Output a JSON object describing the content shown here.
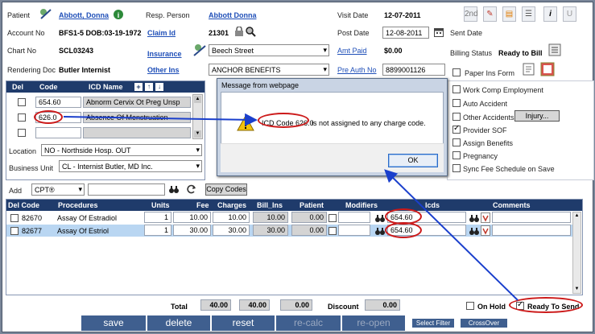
{
  "header": {
    "patient_label": "Patient",
    "patient_name": "Abbott, Donna",
    "resp_person_label": "Resp. Person",
    "resp_person_value": "Abbott Donna",
    "visit_date_label": "Visit Date",
    "visit_date_value": "12-07-2011",
    "account_label": "Account No",
    "account_value": "BFS1-5 DOB:03-19-1972",
    "claim_id_label": "Claim Id",
    "claim_id_value": "21301",
    "post_date_label": "Post Date",
    "post_date_value": "12-08-2011",
    "sent_date_label": "Sent Date",
    "chart_label": "Chart No",
    "chart_value": "SCL03243",
    "insurance_label": "Insurance",
    "insurance_value": "Beech Street",
    "amt_paid_label": "Amt Paid",
    "amt_paid_value": "$0.00",
    "billing_status_label": "Billing Status",
    "billing_status_value": "Ready to Bill",
    "rendering_label": "Rendering Doc",
    "rendering_value": "Butler Internist",
    "other_ins_label": "Other Ins",
    "other_ins_value": "ANCHOR BENEFITS",
    "pre_auth_label": "Pre Auth No",
    "pre_auth_value": "8899001126",
    "paper_ins_label": "Paper Ins Form"
  },
  "toolbar": {
    "btn_2nd": "2nd",
    "btn_info": "i",
    "btn_u": "U"
  },
  "icd": {
    "headers": {
      "del": "Del",
      "code": "Code",
      "name": "ICD Name"
    },
    "rows": [
      {
        "code": "654.60",
        "name": "Abnorm Cervix Ot Preg Unsp"
      },
      {
        "code": "626.0",
        "name": "Absence Of Menstruation"
      },
      {
        "code": "",
        "name": ""
      }
    ]
  },
  "location": {
    "label": "Location",
    "value": "NO - Northside Hosp. OUT"
  },
  "business_unit": {
    "label": "Business Unit",
    "value": "CL - Internist Butler, MD Inc."
  },
  "options": {
    "work_comp": "Work Comp Employment",
    "auto_accident": "Auto Accident",
    "other_accidents": "Other Accidents",
    "injury_btn": "Injury...",
    "provider_sof": "Provider SOF",
    "assign_benefits": "Assign Benefits",
    "pregnancy": "Pregnancy",
    "sync_fee": "Sync Fee Schedule on Save"
  },
  "add_bar": {
    "add_label": "Add",
    "code_type": "CPT®",
    "copy_codes": "Copy Codes"
  },
  "procedures": {
    "headers": {
      "del_code": "Del Code",
      "procedures": "Procedures",
      "units": "Units",
      "fee": "Fee",
      "charges": "Charges",
      "bill_ins": "Bill_Ins",
      "patient": "Patient",
      "modifiers": "Modifiers",
      "icds": "Icds",
      "comments": "Comments"
    },
    "rows": [
      {
        "code": "82670",
        "procedure": "Assay Of Estradiol",
        "units": "1",
        "fee": "10.00",
        "charges": "10.00",
        "bill_ins": "10.00",
        "patient": "0.00",
        "icds": "654.60"
      },
      {
        "code": "82677",
        "procedure": "Assay Of Estriol",
        "units": "1",
        "fee": "30.00",
        "charges": "30.00",
        "bill_ins": "30.00",
        "patient": "0.00",
        "icds": "654.60"
      }
    ]
  },
  "totals": {
    "total_label": "Total",
    "charges": "40.00",
    "bill_ins": "40.00",
    "patient": "0.00",
    "discount_label": "Discount",
    "discount": "0.00",
    "on_hold": "On Hold",
    "ready_to_send": "Ready To Send"
  },
  "bottom": {
    "save": "save",
    "delete": "delete",
    "reset": "reset",
    "recalc": "re-calc",
    "reopen": "re-open",
    "select_filter": "Select Filter",
    "crossover": "CrossOver"
  },
  "dialog": {
    "title": "Message from webpage",
    "message_prefix": "ICD Code 626.0",
    "message_suffix": " is not assigned to any charge code.",
    "ok": "OK"
  },
  "colors": {
    "header_bar": "#1f3b6b",
    "button_blue": "#3f5f8f",
    "link_blue": "#1f4fb8",
    "annotation_red": "#cc1a1a",
    "arrow_blue": "#1a3fcc"
  }
}
